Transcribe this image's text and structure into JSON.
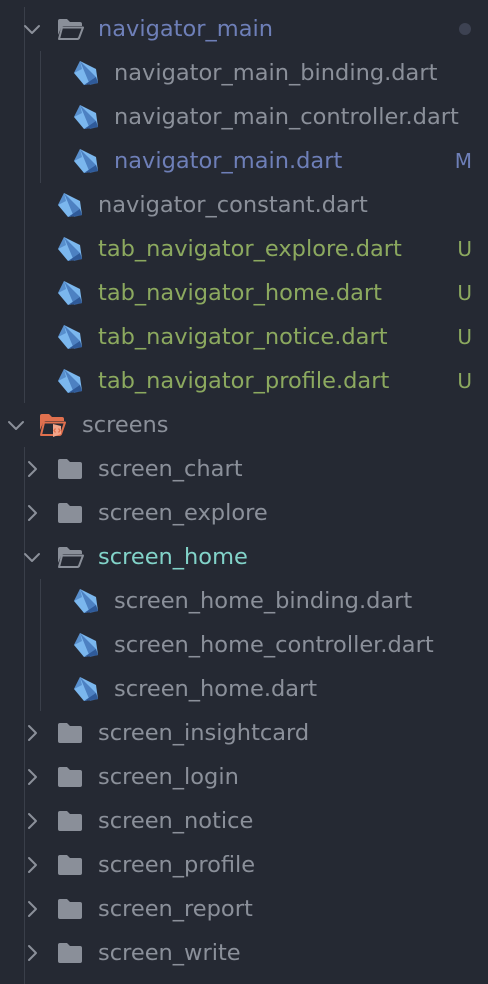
{
  "colors": {
    "background": "#252933",
    "text_default": "#8b909a",
    "text_modified": "#6e7fb8",
    "text_untracked": "#8ca95f",
    "text_selected_folder": "#82d3c9",
    "chevron": "#8b909a",
    "folder_icon": "#8a8f99",
    "dart_light": "#7bb7ee",
    "dart_dark": "#3d6fb3",
    "special_folder": "#e0704e"
  },
  "tree": [
    {
      "label": "navigator_main",
      "kind": "folder-open",
      "level": 1,
      "status": "modified",
      "indicator": "dot"
    },
    {
      "label": "navigator_main_binding.dart",
      "kind": "dart",
      "level": 2,
      "status": "none"
    },
    {
      "label": "navigator_main_controller.dart",
      "kind": "dart",
      "level": 2,
      "status": "none"
    },
    {
      "label": "navigator_main.dart",
      "kind": "dart",
      "level": 2,
      "status": "modified",
      "badge": "M"
    },
    {
      "label": "navigator_constant.dart",
      "kind": "dart",
      "level": 1,
      "status": "none"
    },
    {
      "label": "tab_navigator_explore.dart",
      "kind": "dart",
      "level": 1,
      "status": "untracked",
      "badge": "U"
    },
    {
      "label": "tab_navigator_home.dart",
      "kind": "dart",
      "level": 1,
      "status": "untracked",
      "badge": "U"
    },
    {
      "label": "tab_navigator_notice.dart",
      "kind": "dart",
      "level": 1,
      "status": "untracked",
      "badge": "U"
    },
    {
      "label": "tab_navigator_profile.dart",
      "kind": "dart",
      "level": 1,
      "status": "untracked",
      "badge": "U"
    },
    {
      "label": "screens",
      "kind": "folder-special-open",
      "level": 0,
      "status": "none"
    },
    {
      "label": "screen_chart",
      "kind": "folder-closed",
      "level": 1,
      "status": "none"
    },
    {
      "label": "screen_explore",
      "kind": "folder-closed",
      "level": 1,
      "status": "none"
    },
    {
      "label": "screen_home",
      "kind": "folder-open",
      "level": 1,
      "status": "selected"
    },
    {
      "label": "screen_home_binding.dart",
      "kind": "dart",
      "level": 2,
      "status": "none"
    },
    {
      "label": "screen_home_controller.dart",
      "kind": "dart",
      "level": 2,
      "status": "none"
    },
    {
      "label": "screen_home.dart",
      "kind": "dart",
      "level": 2,
      "status": "none"
    },
    {
      "label": "screen_insightcard",
      "kind": "folder-closed",
      "level": 1,
      "status": "none"
    },
    {
      "label": "screen_login",
      "kind": "folder-closed",
      "level": 1,
      "status": "none"
    },
    {
      "label": "screen_notice",
      "kind": "folder-closed",
      "level": 1,
      "status": "none"
    },
    {
      "label": "screen_profile",
      "kind": "folder-closed",
      "level": 1,
      "status": "none"
    },
    {
      "label": "screen_report",
      "kind": "folder-closed",
      "level": 1,
      "status": "none"
    },
    {
      "label": "screen_write",
      "kind": "folder-closed",
      "level": 1,
      "status": "none"
    },
    {
      "label": "",
      "kind": "dart",
      "level": 1,
      "status": "none"
    }
  ]
}
